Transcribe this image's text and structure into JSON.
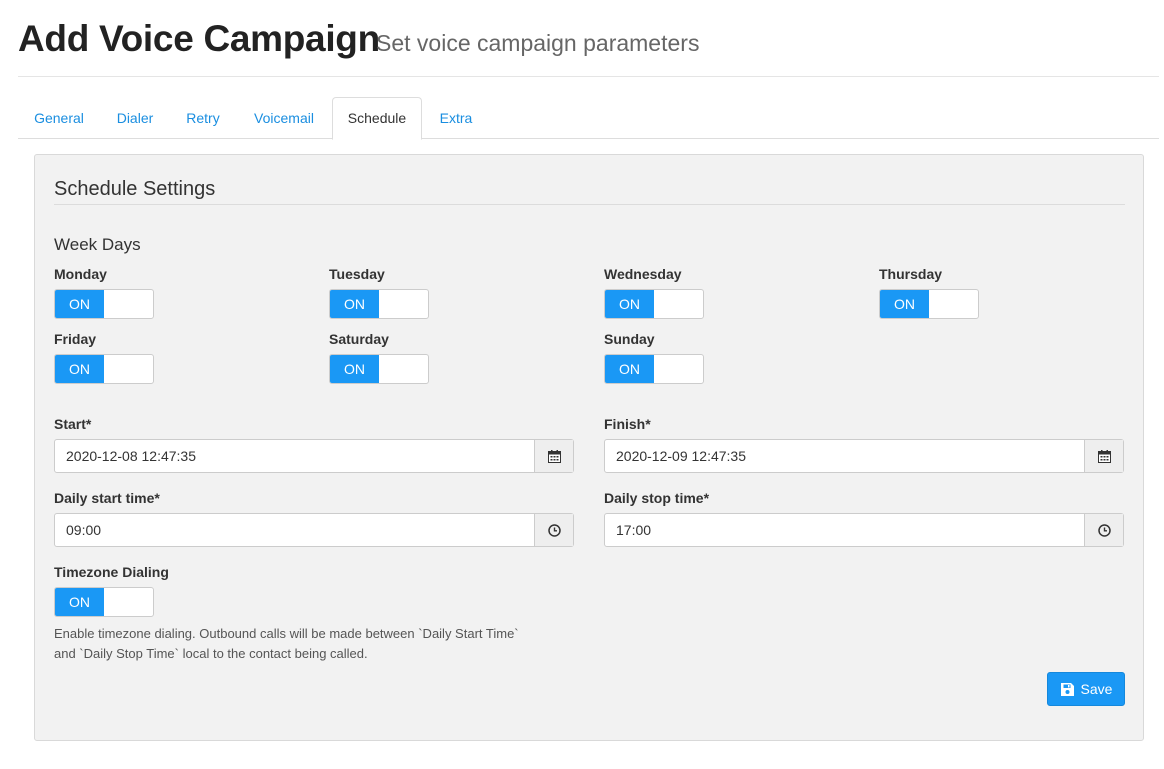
{
  "header": {
    "title": "Add Voice Campaign",
    "subtitle": "Set voice campaign parameters"
  },
  "tabs": [
    {
      "label": "General"
    },
    {
      "label": "Dialer"
    },
    {
      "label": "Retry"
    },
    {
      "label": "Voicemail"
    },
    {
      "label": "Schedule",
      "active": true
    },
    {
      "label": "Extra"
    }
  ],
  "panel": {
    "title": "Schedule Settings",
    "week_days_title": "Week Days",
    "days": [
      {
        "label": "Monday",
        "state": "ON"
      },
      {
        "label": "Tuesday",
        "state": "ON"
      },
      {
        "label": "Wednesday",
        "state": "ON"
      },
      {
        "label": "Thursday",
        "state": "ON"
      },
      {
        "label": "Friday",
        "state": "ON"
      },
      {
        "label": "Saturday",
        "state": "ON"
      },
      {
        "label": "Sunday",
        "state": "ON"
      }
    ],
    "start": {
      "label": "Start*",
      "value": "2020-12-08 12:47:35",
      "icon": "calendar-icon"
    },
    "finish": {
      "label": "Finish*",
      "value": "2020-12-09 12:47:35",
      "icon": "calendar-icon"
    },
    "daily_start": {
      "label": "Daily start time*",
      "value": "09:00",
      "icon": "clock-icon"
    },
    "daily_stop": {
      "label": "Daily stop time*",
      "value": "17:00",
      "icon": "clock-icon"
    },
    "timezone": {
      "label": "Timezone Dialing",
      "state": "ON",
      "help_line1": "Enable timezone dialing. Outbound calls will be made between `Daily Start Time`",
      "help_line2": "and `Daily Stop Time` local to the contact being called."
    },
    "save_label": "Save"
  },
  "colors": {
    "accent": "#1a98f5",
    "link": "#1a8ee0",
    "panel_bg": "#f2f2f2"
  }
}
